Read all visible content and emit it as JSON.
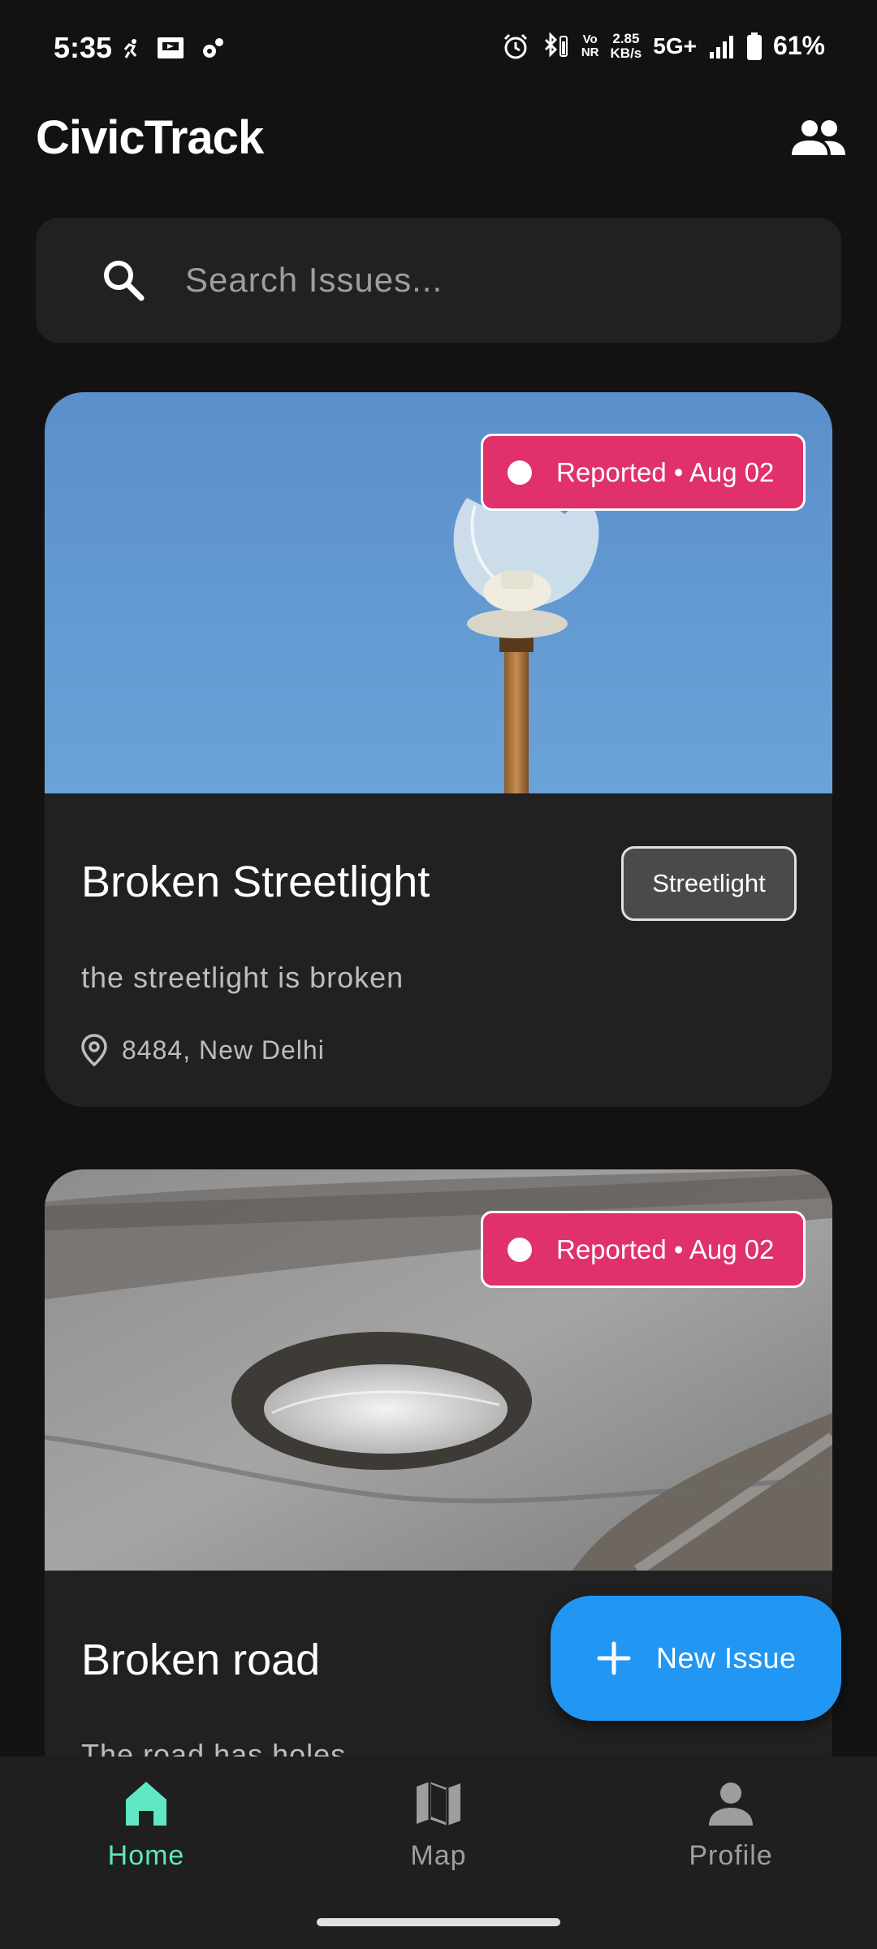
{
  "status_bar": {
    "time": "5:35",
    "net_speed_value": "2.85",
    "net_speed_unit": "KB/s",
    "vonr_top": "Vo",
    "vonr_bottom": "NR",
    "network": "5G+",
    "battery": "61%"
  },
  "app_bar": {
    "title": "CivicTrack",
    "action_icon": "people-icon"
  },
  "search": {
    "placeholder": "Search Issues..."
  },
  "issues": [
    {
      "status": "Reported • Aug 02",
      "title": "Broken Streetlight",
      "category": "Streetlight",
      "description": "the streetlight is broken",
      "location": "8484, New Delhi"
    },
    {
      "status": "Reported • Aug 02",
      "title": "Broken road",
      "description": "The road has holes"
    }
  ],
  "fab": {
    "label": "New Issue"
  },
  "bottom_nav": {
    "items": [
      {
        "label": "Home",
        "icon": "home-icon",
        "active": true
      },
      {
        "label": "Map",
        "icon": "map-icon",
        "active": false
      },
      {
        "label": "Profile",
        "icon": "person-icon",
        "active": false
      }
    ]
  },
  "colors": {
    "background": "#121212",
    "surface": "#212121",
    "status_chip": "#e0316a",
    "fab": "#2196f3",
    "nav_active": "#5ee7c2"
  }
}
